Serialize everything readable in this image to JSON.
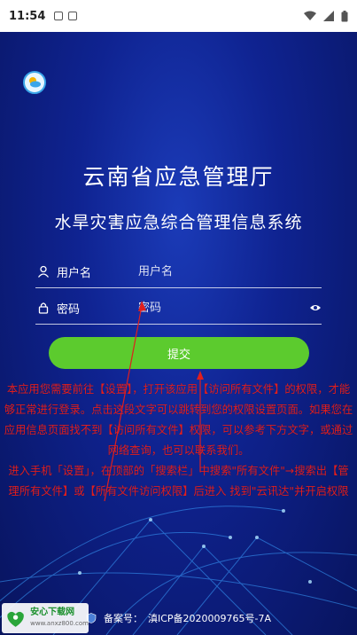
{
  "status_bar": {
    "time": "11:54"
  },
  "app": {
    "title": "云南省应急管理厅",
    "subtitle": "水旱灾害应急综合管理信息系统"
  },
  "login": {
    "username_label": "用户名",
    "username_placeholder": "用户名",
    "password_label": "密码",
    "password_placeholder": "密码",
    "submit_label": "提交"
  },
  "notice": {
    "paragraph1": "本应用您需要前往【设置】，打开该应用【访问所有文件】的权限，才能够正常进行登录。点击这段文字可以跳转到您的权限设置页面。如果您在应用信息页面找不到【访问所有文件】权限，可以参考下方文字，或通过网络查询，也可以联系我们。",
    "paragraph2": "进入手机「设置」，在顶部的「搜索栏」中搜索\"所有文件\"→搜索出【管理所有文件】或【所有文件访问权限】后进入 找到\"云讯达\"并开启权限"
  },
  "footer": {
    "record_label": "备案号：",
    "record_number": "滇ICP备2020009765号-7A"
  },
  "watermark": {
    "title": "安心下载网",
    "url": "www.anxz800.com"
  },
  "colors": {
    "submit_button": "#5ccb2e",
    "notice_text": "#e01e1e",
    "background": "#0f2391"
  }
}
